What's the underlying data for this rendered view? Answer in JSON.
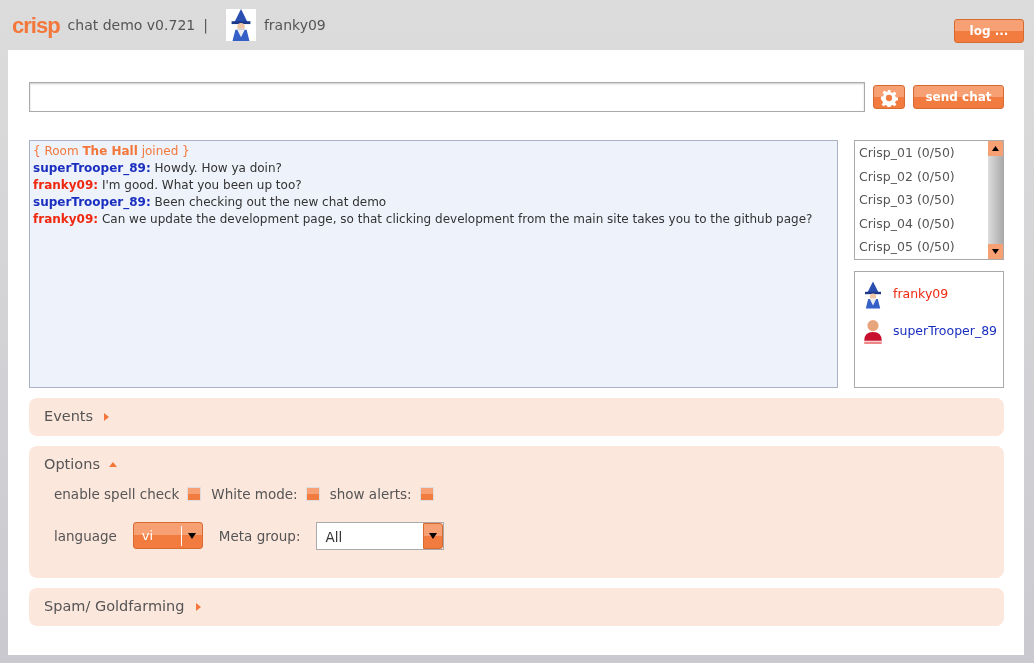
{
  "header": {
    "logo": "crisp",
    "title": "chat demo v0.721",
    "separator": "|",
    "username": "franky09",
    "log_button": "log ..."
  },
  "composer": {
    "send_button": "send chat"
  },
  "messages": [
    {
      "kind": "system",
      "text": "{ Room **The Hall** joined }"
    },
    {
      "kind": "chat",
      "author": "superTrooper_89:",
      "color": "#1a2fc0",
      "text": "Howdy. How ya doin?"
    },
    {
      "kind": "chat",
      "author": "franky09:",
      "color": "#f0280f",
      "text": "I'm good. What you been up too?"
    },
    {
      "kind": "chat",
      "author": "superTrooper_89:",
      "color": "#1a2fc0",
      "text": "Been checking out the new chat demo"
    },
    {
      "kind": "chat",
      "author": "franky09:",
      "color": "#f0280f",
      "text": "Can we update the development page, so that clicking development from the main site takes you to the github page?"
    }
  ],
  "rooms": [
    "Crisp_01 (0/50)",
    "Crisp_02 (0/50)",
    "Crisp_03 (0/50)",
    "Crisp_04 (0/50)",
    "Crisp_05 (0/50)"
  ],
  "users": [
    {
      "name": "franky09",
      "kind": "wizard",
      "color": "#f0280f"
    },
    {
      "name": "superTrooper_89",
      "kind": "person",
      "color": "#1a2fc0"
    }
  ],
  "sections": [
    {
      "title": "Events",
      "expanded": false
    },
    {
      "title": "Options",
      "expanded": true,
      "checkboxes": [
        {
          "label": "enable spell check",
          "checked": false
        },
        {
          "label": "White mode:",
          "checked": false
        },
        {
          "label": "show alerts:",
          "checked": false
        }
      ],
      "language": {
        "label": "language",
        "value": "vi"
      },
      "meta_group": {
        "label": "Meta group:",
        "value": "All"
      }
    },
    {
      "title": "Spam/ Goldfarming",
      "expanded": false
    }
  ]
}
